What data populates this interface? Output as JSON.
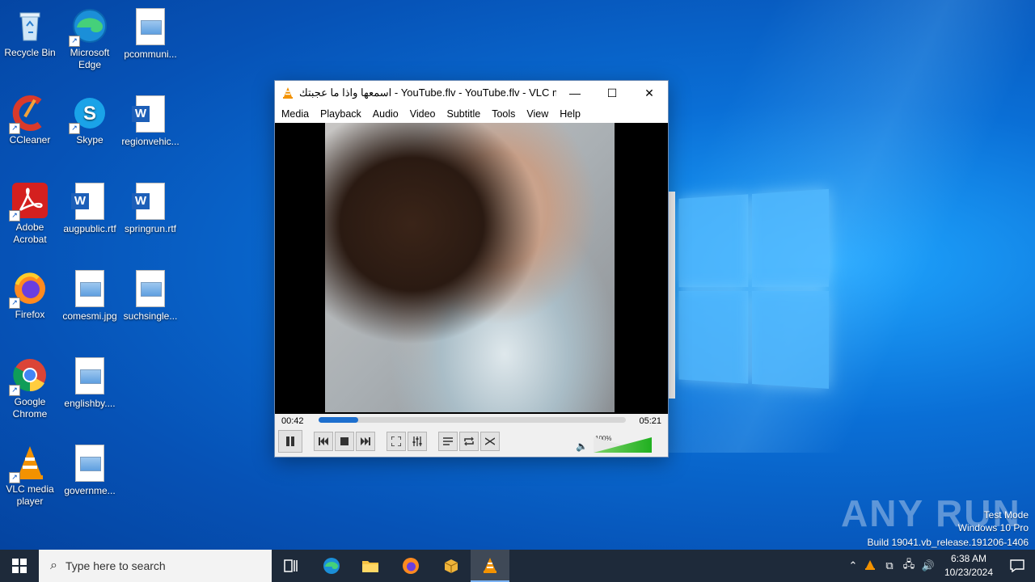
{
  "desktop": {
    "icons": [
      {
        "label": "Recycle Bin"
      },
      {
        "label": "Microsoft Edge"
      },
      {
        "label": "pcommuni..."
      },
      {
        "label": "CCleaner"
      },
      {
        "label": "Skype"
      },
      {
        "label": "regionvehic..."
      },
      {
        "label": "Adobe Acrobat"
      },
      {
        "label": "augpublic.rtf"
      },
      {
        "label": "springrun.rtf"
      },
      {
        "label": "Firefox"
      },
      {
        "label": "comesmi.jpg"
      },
      {
        "label": "suchsingle..."
      },
      {
        "label": "Google Chrome"
      },
      {
        "label": "englishby...."
      },
      {
        "label": "VLC media player"
      },
      {
        "label": "governme..."
      }
    ]
  },
  "vlc": {
    "title": "اسمعها واذا ما عجبتك - YouTube.flv - YouTube.flv - VLC me...",
    "menu": [
      "Media",
      "Playback",
      "Audio",
      "Video",
      "Subtitle",
      "Tools",
      "View",
      "Help"
    ],
    "time_current": "00:42",
    "time_total": "05:21",
    "progress_fraction": 0.13,
    "volume_label": "100%",
    "volume_fraction": 1.0
  },
  "watermark": {
    "brand": "ANY RUN",
    "line1": "Test Mode",
    "line2": "Windows 10 Pro",
    "line3": "Build 19041.vb_release.191206-1406"
  },
  "taskbar": {
    "search_placeholder": "Type here to search",
    "time": "6:38 AM",
    "date": "10/23/2024"
  }
}
